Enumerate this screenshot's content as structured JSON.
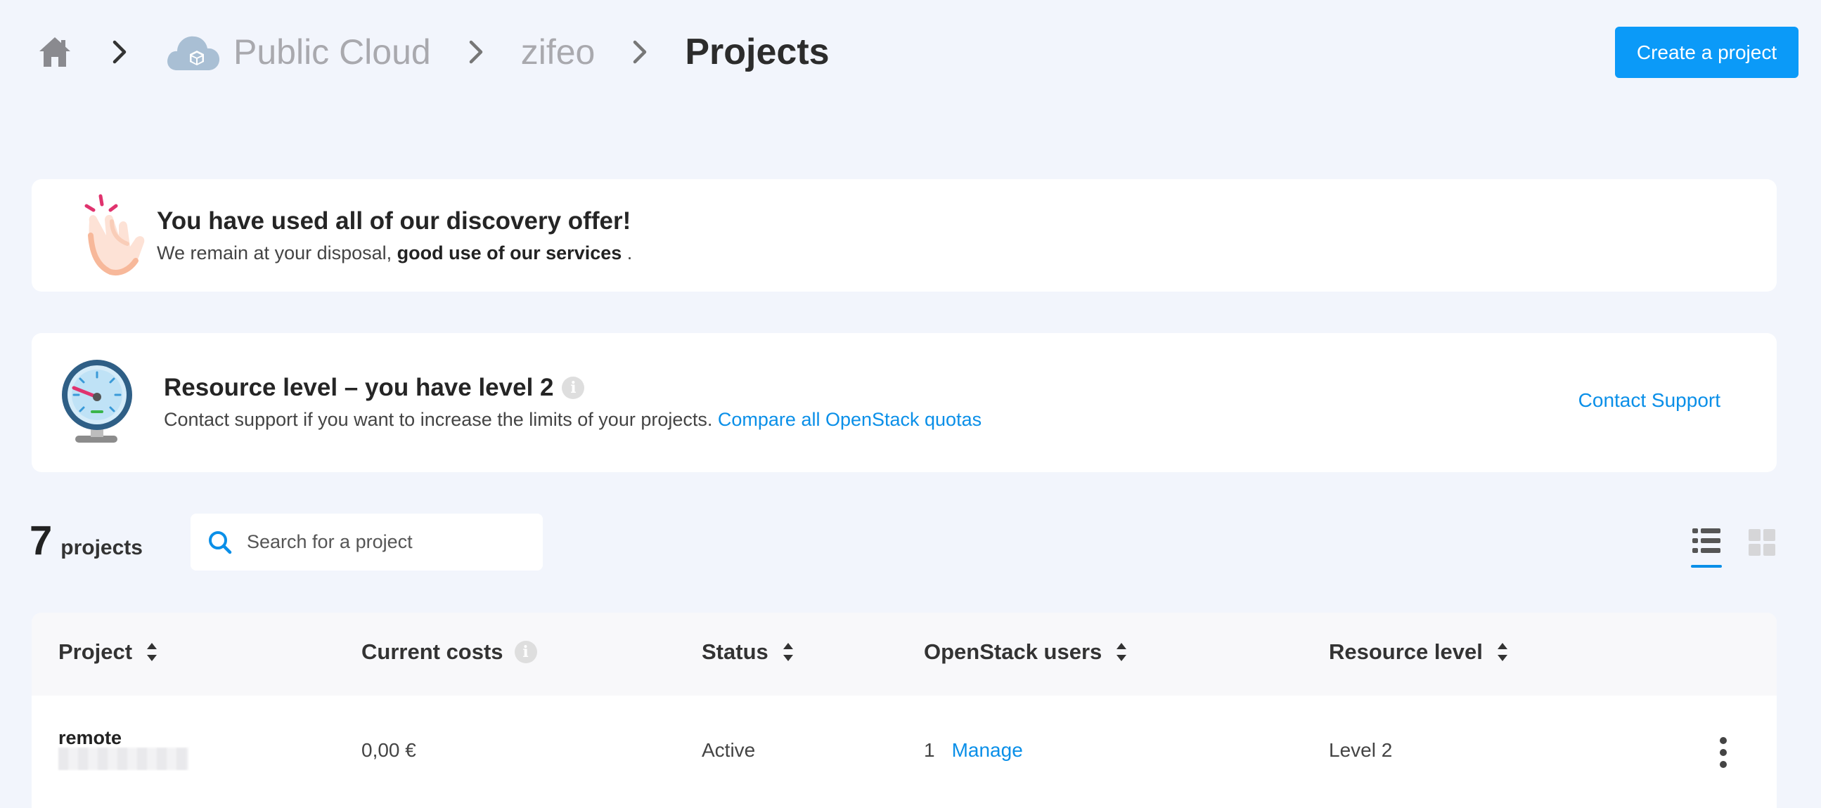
{
  "breadcrumb": {
    "home_icon": "home-icon",
    "section": "Public Cloud",
    "account": "zifeo",
    "current": "Projects"
  },
  "header": {
    "create_button": "Create a project"
  },
  "discovery_banner": {
    "title": "You have used all of our discovery offer!",
    "text_before": "We remain at your disposal,",
    "text_bold": "good use of our services",
    "text_after": "."
  },
  "resource_banner": {
    "title": "Resource level – you have level 2",
    "info_glyph": "i",
    "text": "Contact support if you want to increase the limits of your projects.",
    "link": "Compare all OpenStack quotas",
    "contact_link": "Contact Support"
  },
  "projects_toolbar": {
    "count": "7",
    "count_label": "projects",
    "search_placeholder": "Search for a project",
    "views": [
      "list-view-icon",
      "grid-view-icon"
    ],
    "active_view": "list"
  },
  "table": {
    "columns": [
      {
        "label": "Project",
        "sortable": true
      },
      {
        "label": "Current costs",
        "info": "i"
      },
      {
        "label": "Status",
        "sortable": true
      },
      {
        "label": "OpenStack users",
        "sortable": true
      },
      {
        "label": "Resource level",
        "sortable": true
      }
    ],
    "rows": [
      {
        "project": "remote",
        "current_costs": "0,00 €",
        "status": "Active",
        "users_count": "1",
        "users_action": "Manage",
        "resource_level": "Level 2"
      }
    ]
  },
  "colors": {
    "background": "#f2f5fc",
    "accent": "#0b9af8",
    "link": "#0a8fe8"
  }
}
